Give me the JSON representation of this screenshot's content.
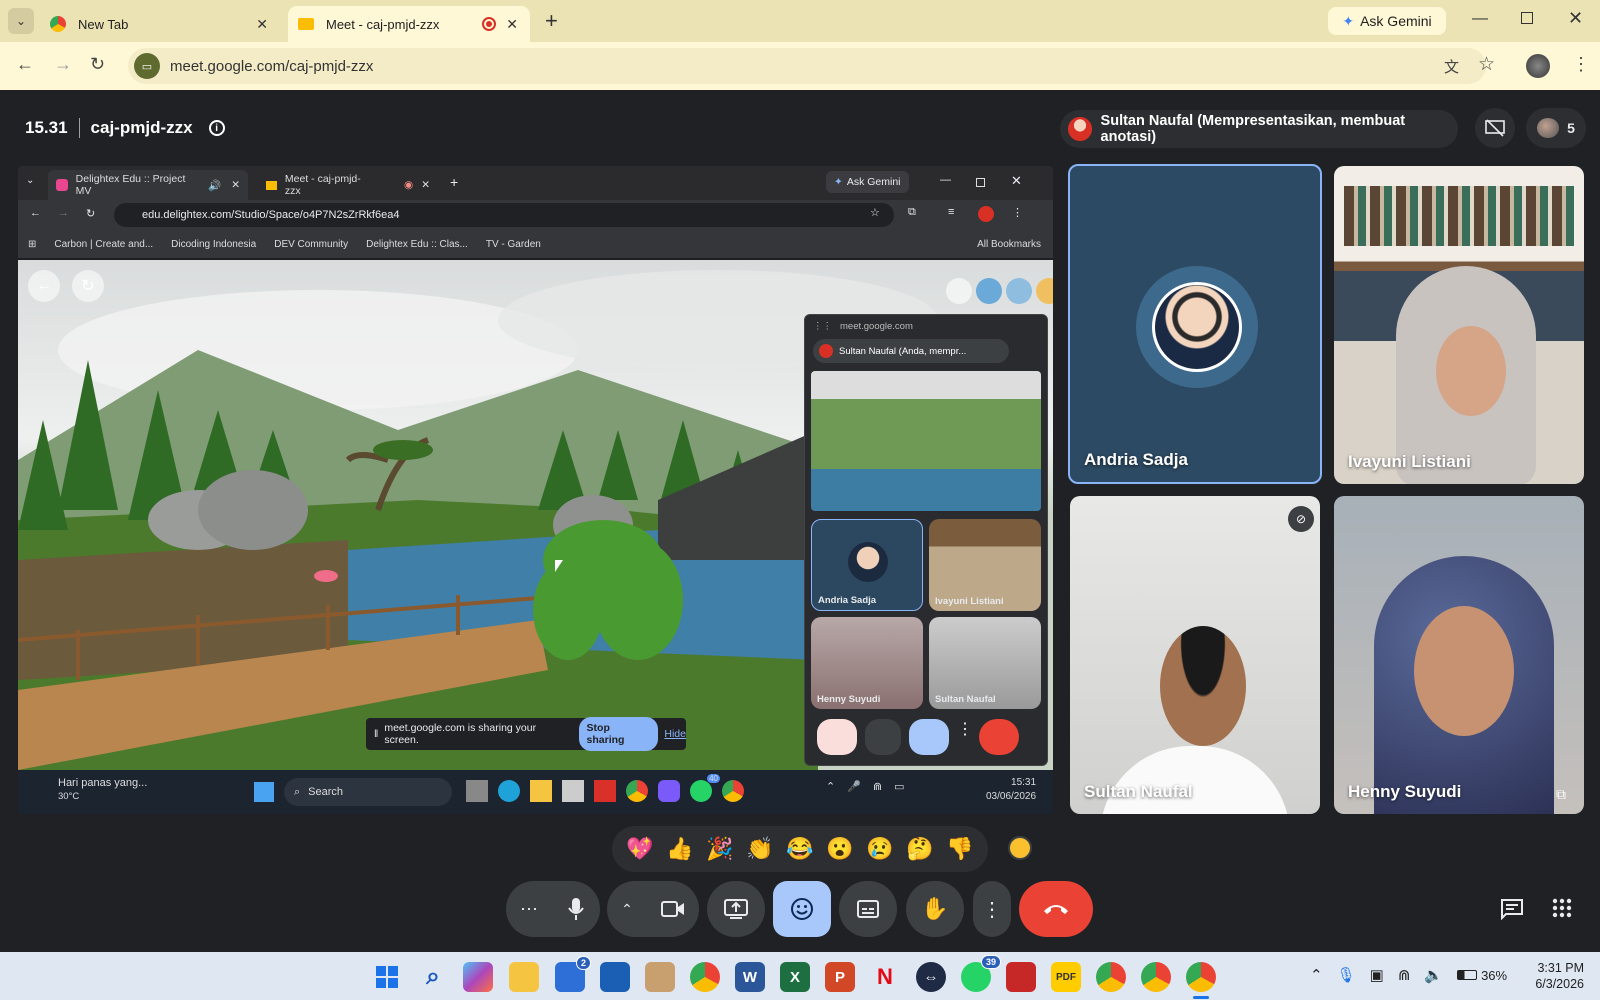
{
  "browser": {
    "tabs": [
      {
        "title": "New Tab"
      },
      {
        "title": "Meet - caj-pmjd-zzx"
      }
    ],
    "ask_gemini": "Ask Gemini",
    "url": "meet.google.com/caj-pmjd-zzx"
  },
  "meet": {
    "time": "15.31",
    "meeting_code": "caj-pmjd-zzx",
    "presenter_label": "Sultan Naufal (Mempresentasikan, membuat anotasi)",
    "participant_count": "5",
    "participants": [
      {
        "name": "Andria Sadja"
      },
      {
        "name": "Ivayuni Listiani"
      },
      {
        "name": "Sultan Naufal"
      },
      {
        "name": "Henny Suyudi"
      }
    ],
    "reactions": [
      "💖",
      "👍",
      "🎉",
      "👏",
      "😂",
      "😮",
      "😢",
      "🤔",
      "👎"
    ]
  },
  "shared_screen": {
    "tabs": [
      {
        "title": "Delightex Edu :: Project MV"
      },
      {
        "title": "Meet - caj-pmjd-zzx"
      }
    ],
    "ask_gemini": "Ask Gemini",
    "url": "edu.delightex.com/Studio/Space/o4P7N2sZrRkf6ea4",
    "bookmarks": [
      "Carbon | Create and...",
      "Dicoding Indonesia",
      "DEV Community",
      "Delightex Edu :: Clas...",
      "TV - Garden"
    ],
    "all_bookmarks": "All Bookmarks",
    "share_notice": "meet.google.com is sharing your screen.",
    "stop_sharing": "Stop sharing",
    "hide": "Hide",
    "float_domain": "meet.google.com",
    "float_presenter": "Sultan Naufal (Anda, mempr...",
    "float_tiles": [
      "Andria Sadja",
      "Ivayuni Listiani",
      "Henny Suyudi",
      "Sultan Naufal"
    ],
    "weather_text": "Hari panas yang...",
    "weather_temp": "30°C",
    "search": "Search",
    "whatsapp_badge": "40",
    "time": "15:31",
    "date": "03/06/2026"
  },
  "taskbar": {
    "store_badge": "2",
    "whatsapp_badge": "39",
    "battery": "36%",
    "time": "3:31 PM",
    "date": "6/3/2026"
  },
  "colors": {
    "accent_blue": "#8ab4f8",
    "end_call_red": "#ea4335",
    "tab_bar": "#ece3b5"
  }
}
